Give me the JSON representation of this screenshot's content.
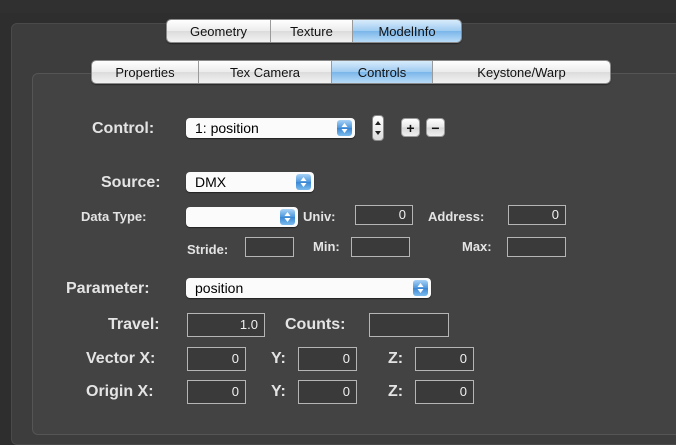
{
  "tabs_main": [
    {
      "label": "Geometry",
      "active": false
    },
    {
      "label": "Texture",
      "active": false
    },
    {
      "label": "ModelInfo",
      "active": true
    }
  ],
  "tabs_sub": [
    {
      "label": "Properties",
      "active": false
    },
    {
      "label": "Tex Camera",
      "active": false
    },
    {
      "label": "Controls",
      "active": true
    },
    {
      "label": "Keystone/Warp",
      "active": false
    }
  ],
  "control": {
    "label": "Control:",
    "value": "1: position",
    "add_label": "+",
    "remove_label": "−"
  },
  "source": {
    "label": "Source:",
    "value": "DMX"
  },
  "data_type": {
    "label": "Data Type:",
    "value": ""
  },
  "univ": {
    "label": "Univ:",
    "value": "0"
  },
  "address": {
    "label": "Address:",
    "value": "0"
  },
  "stride": {
    "label": "Stride:",
    "value": ""
  },
  "min": {
    "label": "Min:",
    "value": ""
  },
  "max": {
    "label": "Max:",
    "value": ""
  },
  "parameter": {
    "label": "Parameter:",
    "value": "position"
  },
  "travel": {
    "label": "Travel:",
    "value": "1.0"
  },
  "counts": {
    "label": "Counts:",
    "value": ""
  },
  "vector": {
    "x_label": "Vector X:",
    "x": "0",
    "y_label": "Y:",
    "y": "0",
    "z_label": "Z:",
    "z": "0"
  },
  "origin": {
    "x_label": "Origin X:",
    "x": "0",
    "y_label": "Y:",
    "y": "0",
    "z_label": "Z:",
    "z": "0"
  },
  "colors": {
    "active_tab": "#8ec3ee",
    "popup_arrow": "#3a86d4",
    "panel": "#434343"
  }
}
